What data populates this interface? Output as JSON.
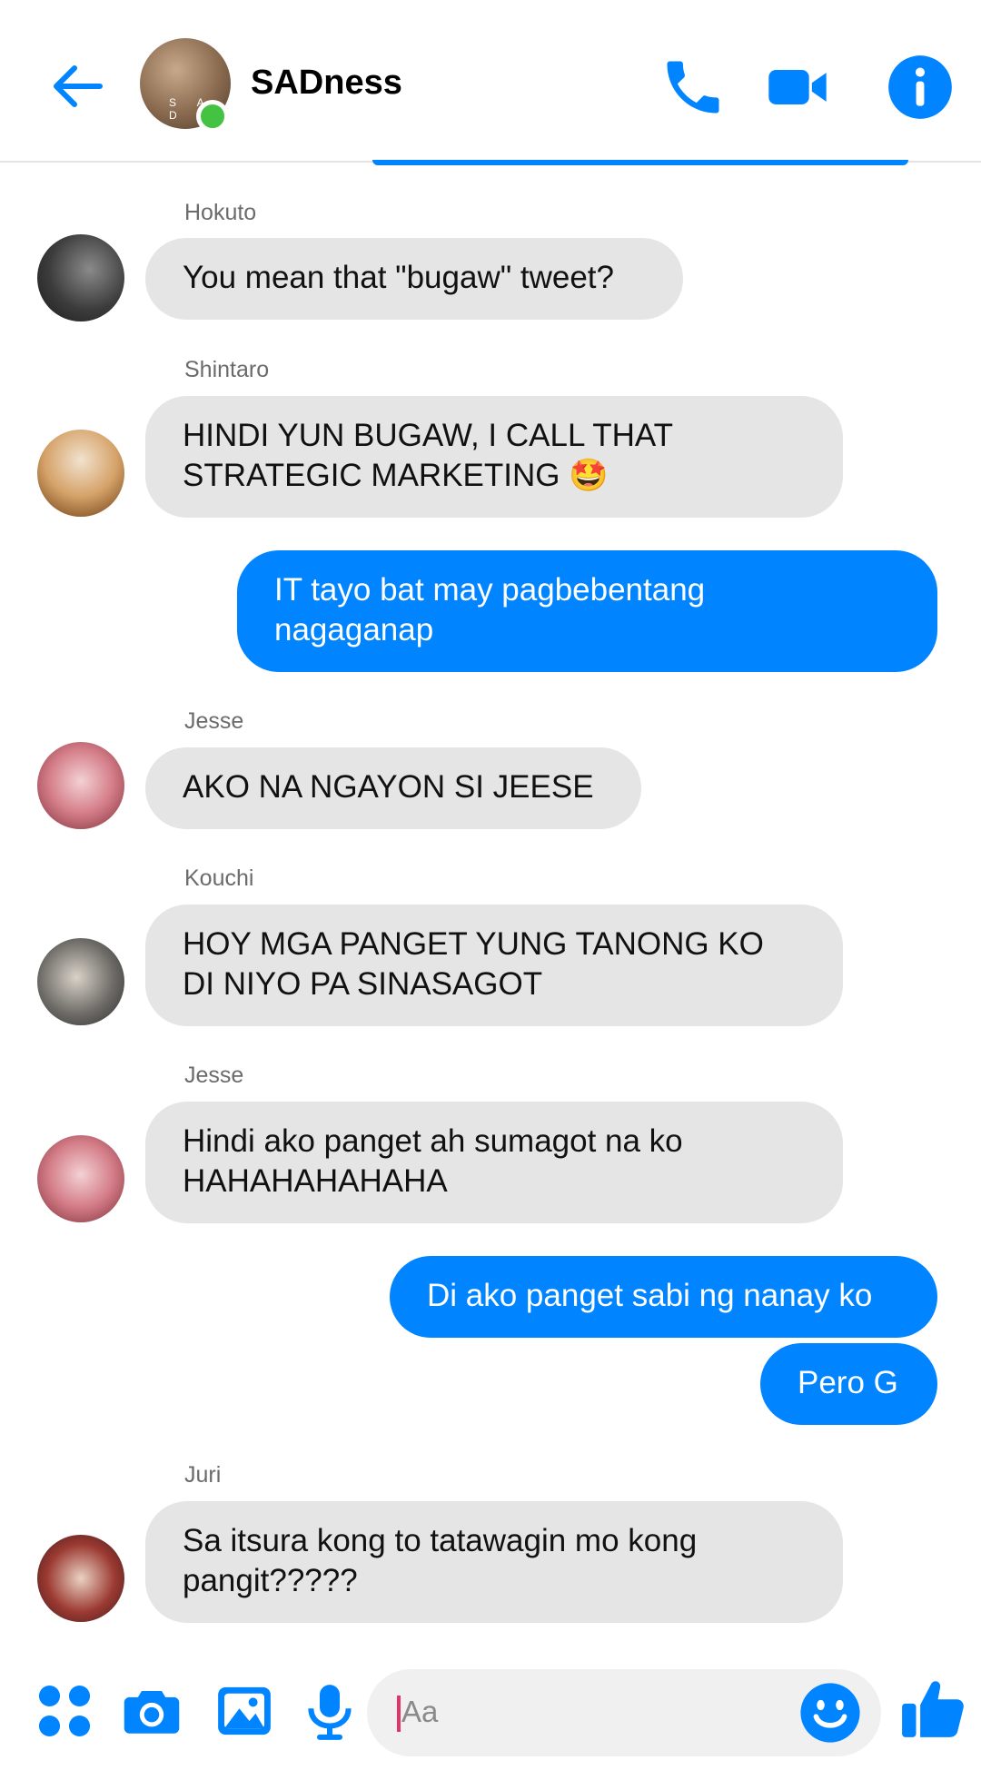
{
  "header": {
    "title": "SADness",
    "avatar_text": "S A D"
  },
  "messages": [
    {
      "sender": "Hokuto",
      "text": "You mean that \"bugaw\" tweet?"
    },
    {
      "sender": "Shintaro",
      "text_line1": "HINDI YUN BUGAW, I CALL THAT",
      "text_line2": "STRATEGIC MARKETING 🤩"
    },
    {
      "outgoing": true,
      "text_line1": "IT tayo bat may pagbebentang",
      "text_line2": "nagaganap"
    },
    {
      "sender": "Jesse",
      "text": "AKO NA NGAYON SI JEESE"
    },
    {
      "sender": "Kouchi",
      "text_line1": "HOY MGA PANGET YUNG TANONG KO",
      "text_line2": "DI NIYO PA SINASAGOT"
    },
    {
      "sender": "Jesse",
      "text_line1": "Hindi ako panget ah sumagot na ko",
      "text_line2": "HAHAHAHAHAHA"
    },
    {
      "outgoing": true,
      "text": "Di ako panget sabi ng nanay ko"
    },
    {
      "outgoing": true,
      "text": "Pero G"
    },
    {
      "sender": "Juri",
      "text_line1": "Sa itsura kong to tatawagin mo kong",
      "text_line2": "pangit?????"
    }
  ],
  "composer": {
    "placeholder": "Aa"
  },
  "colors": {
    "accent": "#0084ff",
    "incoming_bubble": "#e5e5e5",
    "online": "#44c342"
  },
  "icons": [
    "back-arrow-icon",
    "phone-icon",
    "video-camera-icon",
    "info-icon",
    "apps-icon",
    "camera-icon",
    "gallery-icon",
    "microphone-icon",
    "emoji-icon",
    "thumbs-up-icon"
  ]
}
